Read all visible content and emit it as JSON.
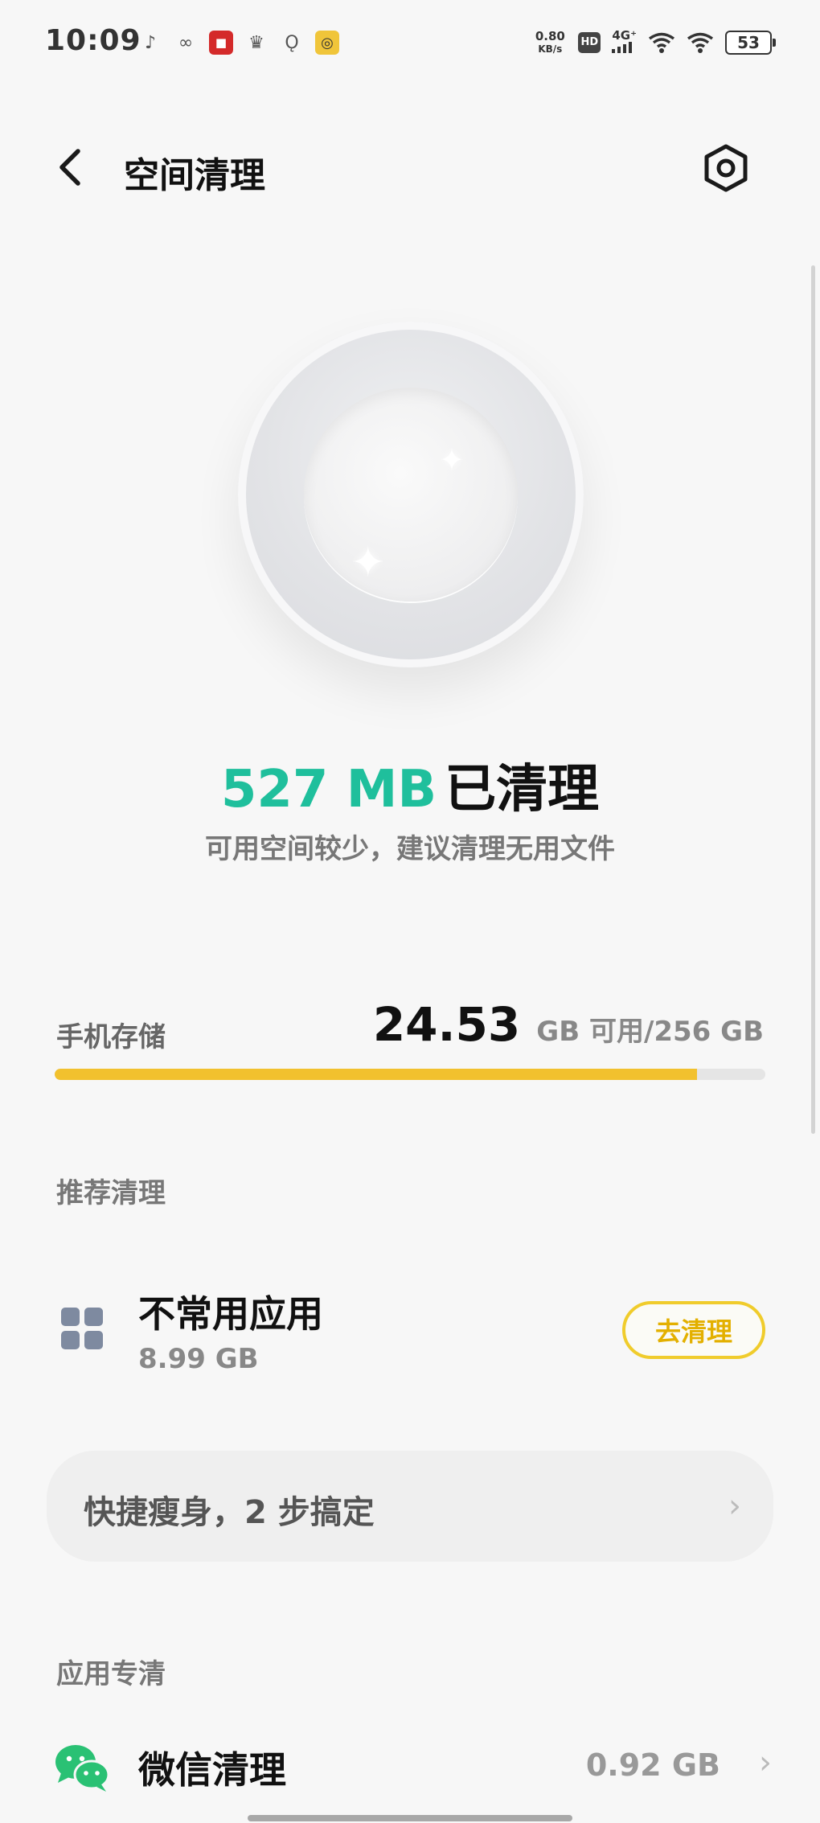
{
  "status_bar": {
    "time": "10:09",
    "net_speed_value": "0.80",
    "net_speed_unit": "KB/s",
    "hd": "HD",
    "signal": "4G⁺",
    "battery": "53"
  },
  "header": {
    "title": "空间清理"
  },
  "result": {
    "amount": "527 MB",
    "label": "已清理",
    "tip": "可用空间较少，建议清理无用文件"
  },
  "storage": {
    "label": "手机存储",
    "free": "24.53",
    "unit_text": "GB 可用/256 GB",
    "used_fraction": 0.904
  },
  "recommend": {
    "section_title": "推荐清理",
    "item_title": "不常用应用",
    "item_size": "8.99 GB",
    "button_label": "去清理"
  },
  "quick": {
    "label": "快捷瘦身，2 步搞定"
  },
  "app_clean": {
    "section_title": "应用专清",
    "wechat_title": "微信清理",
    "wechat_size": "0.92 GB"
  },
  "colors": {
    "accent_green": "#1fbf9c",
    "accent_yellow": "#f2c12e",
    "wechat_green": "#2ac174"
  }
}
